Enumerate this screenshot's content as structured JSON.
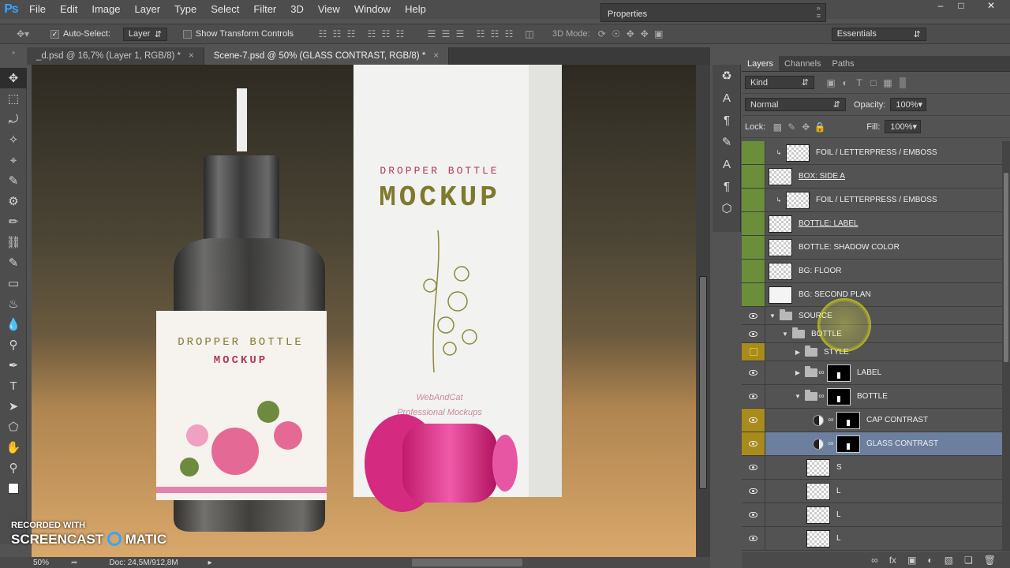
{
  "app": {
    "logo": "Ps"
  },
  "menu": [
    "File",
    "Edit",
    "Image",
    "Layer",
    "Type",
    "Select",
    "Filter",
    "3D",
    "View",
    "Window",
    "Help"
  ],
  "properties_tab": "Properties",
  "options": {
    "auto_select_label": "Auto-Select:",
    "auto_select_value": "Layer",
    "transform_label": "Show Transform Controls",
    "mode_3d_label": "3D Mode:",
    "workspace": "Essentials"
  },
  "doc_tabs": [
    {
      "label": "_d.psd @ 16,7% (Layer 1, RGB/8) *",
      "active": false
    },
    {
      "label": "Scene-7.psd @ 50% (GLASS CONTRAST, RGB/8) *",
      "active": true
    }
  ],
  "canvas": {
    "box_title_small": "DROPPER BOTTLE",
    "box_title_big": "MOCKUP",
    "box_brand": "WebAndCat",
    "box_tagline": "Professional Mockups",
    "label_line1": "DROPPER BOTTLE",
    "label_line2": "MOCKUP"
  },
  "status": {
    "zoom": "50%",
    "doc": "Doc: 24,5M/912,8M"
  },
  "watermark": {
    "line1": "RECORDED WITH",
    "line2": "SCREENCAST",
    "line3": "MATIC"
  },
  "layers_panel": {
    "tabs": [
      "Layers",
      "Channels",
      "Paths"
    ],
    "filter_kind": "Kind",
    "blend_mode": "Normal",
    "opacity_label": "Opacity:",
    "opacity_value": "100%",
    "lock_label": "Lock:",
    "fill_label": "Fill:",
    "fill_value": "100%",
    "layers": [
      {
        "name": "FOIL / LETTERPRESS / EMBOSS"
      },
      {
        "name": "BOX: SIDE A"
      },
      {
        "name": "FOIL / LETTERPRESS / EMBOSS"
      },
      {
        "name": "BOTTLE: LABEL"
      },
      {
        "name": "BOTTLE: SHADOW COLOR"
      },
      {
        "name": "BG: FLOOR"
      },
      {
        "name": "BG: SECOND PLAN"
      },
      {
        "name": "SOURCE"
      },
      {
        "name": "BOTTLE"
      },
      {
        "name": "STYLE"
      },
      {
        "name": "LABEL"
      },
      {
        "name": "BOTTLE"
      },
      {
        "name": "CAP CONTRAST"
      },
      {
        "name": "GLASS CONTRAST"
      },
      {
        "name": "S"
      },
      {
        "name": "L"
      },
      {
        "name": "L"
      },
      {
        "name": "L"
      }
    ]
  },
  "colors": {
    "accent": "#31a8ff",
    "selected_layer": "#6d7f9e",
    "group_green": "#6b8e3a",
    "group_orange": "#a88b1b"
  }
}
